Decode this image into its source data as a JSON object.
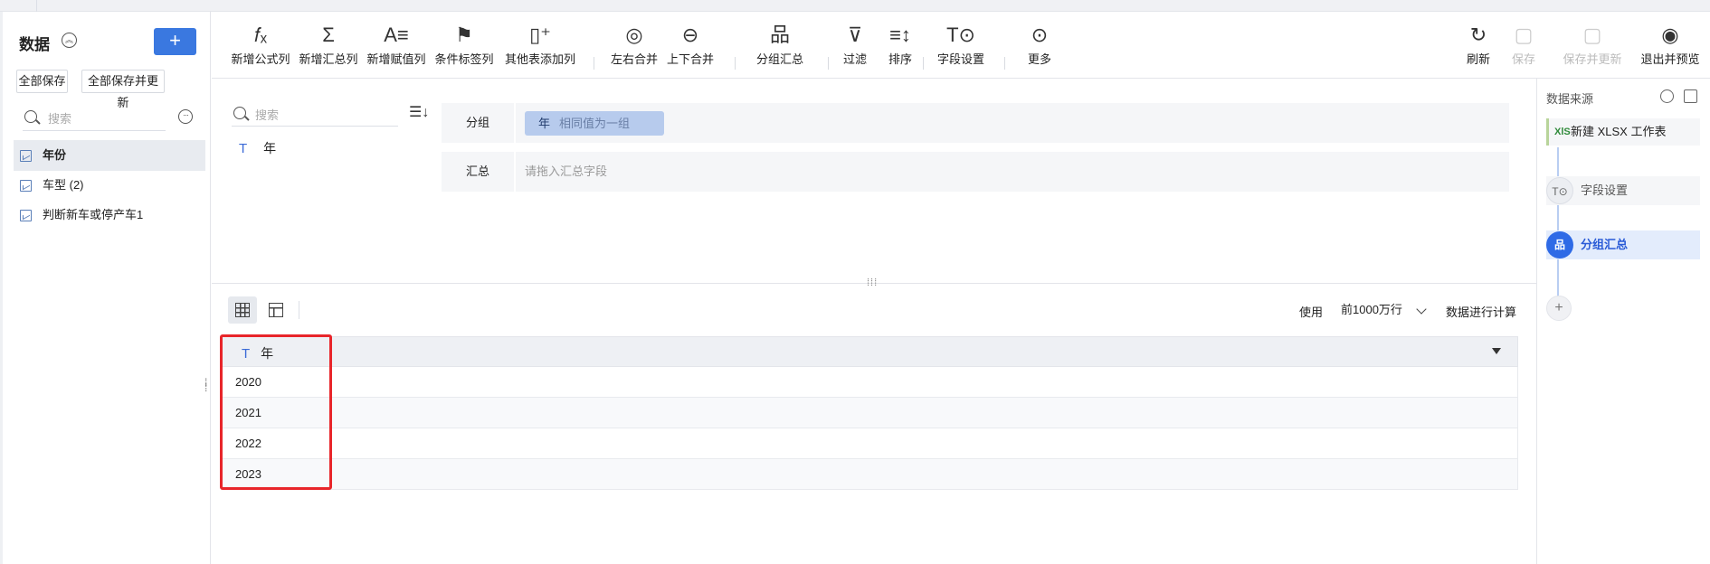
{
  "left": {
    "title": "数据",
    "add_label": "+",
    "save_all": "全部保存",
    "save_all_update": "全部保存并更新",
    "search_placeholder": "搜索",
    "items": [
      {
        "label": "年份",
        "active": true
      },
      {
        "label": "车型 (2)",
        "active": false
      },
      {
        "label": "判断新车或停产车1",
        "active": false
      }
    ]
  },
  "toolbar": {
    "items": [
      {
        "icon": "fx-icon",
        "glyph": "𝑓ₓ",
        "label": "新增公式列"
      },
      {
        "icon": "sigma-icon",
        "glyph": "Σ",
        "label": "新增汇总列"
      },
      {
        "icon": "assign-icon",
        "glyph": "A≡",
        "label": "新增赋值列"
      },
      {
        "icon": "flag-icon",
        "glyph": "⚑",
        "label": "条件标签列"
      },
      {
        "icon": "add-column-icon",
        "glyph": "▯⁺",
        "label": "其他表添加列"
      },
      {
        "icon": "left-right-merge-icon",
        "glyph": "◎",
        "label": "左右合并"
      },
      {
        "icon": "up-down-merge-icon",
        "glyph": "⊖",
        "label": "上下合并"
      },
      {
        "icon": "group-summary-icon",
        "glyph": "品",
        "label": "分组汇总"
      },
      {
        "icon": "filter-icon",
        "glyph": "⊽",
        "label": "过滤"
      },
      {
        "icon": "sort-icon",
        "glyph": "≡↕",
        "label": "排序"
      },
      {
        "icon": "field-settings-icon",
        "glyph": "T⊙",
        "label": "字段设置"
      },
      {
        "icon": "more-icon",
        "glyph": "⊙",
        "label": "更多"
      }
    ],
    "right_items": [
      {
        "icon": "refresh-icon",
        "glyph": "↻",
        "label": "刷新",
        "disabled": false
      },
      {
        "icon": "save-icon",
        "glyph": "▢",
        "label": "保存",
        "disabled": true
      },
      {
        "icon": "save-update-icon",
        "glyph": "▢",
        "label": "保存并更新",
        "disabled": true
      },
      {
        "icon": "exit-preview-icon",
        "glyph": "◉",
        "label": "退出并预览",
        "disabled": false
      }
    ]
  },
  "config": {
    "search_placeholder": "搜索",
    "field_type": "T",
    "field_name": "年",
    "group_label": "分组",
    "group_chip": "年",
    "group_chip_hint": "相同值为一组",
    "summary_label": "汇总",
    "summary_placeholder": "请拖入汇总字段"
  },
  "preview": {
    "use_label": "使用",
    "rows_option": "前1000万行",
    "calc_label": "数据进行计算",
    "column_type": "T",
    "column_name": "年",
    "rows": [
      "2020",
      "2021",
      "2022",
      "2023"
    ]
  },
  "right": {
    "title": "数据来源",
    "source_badge": "XlS",
    "source_name": "新建 XLSX 工作表",
    "steps": [
      {
        "glyph": "T⊙",
        "label": "字段设置"
      },
      {
        "glyph": "品",
        "label": "分组汇总"
      }
    ],
    "add": "+"
  },
  "colors": {
    "accent": "#3a78e0",
    "chip_bg": "#b7cbed",
    "highlight_box": "#e8252a",
    "active_step": "#2e6ae6"
  }
}
